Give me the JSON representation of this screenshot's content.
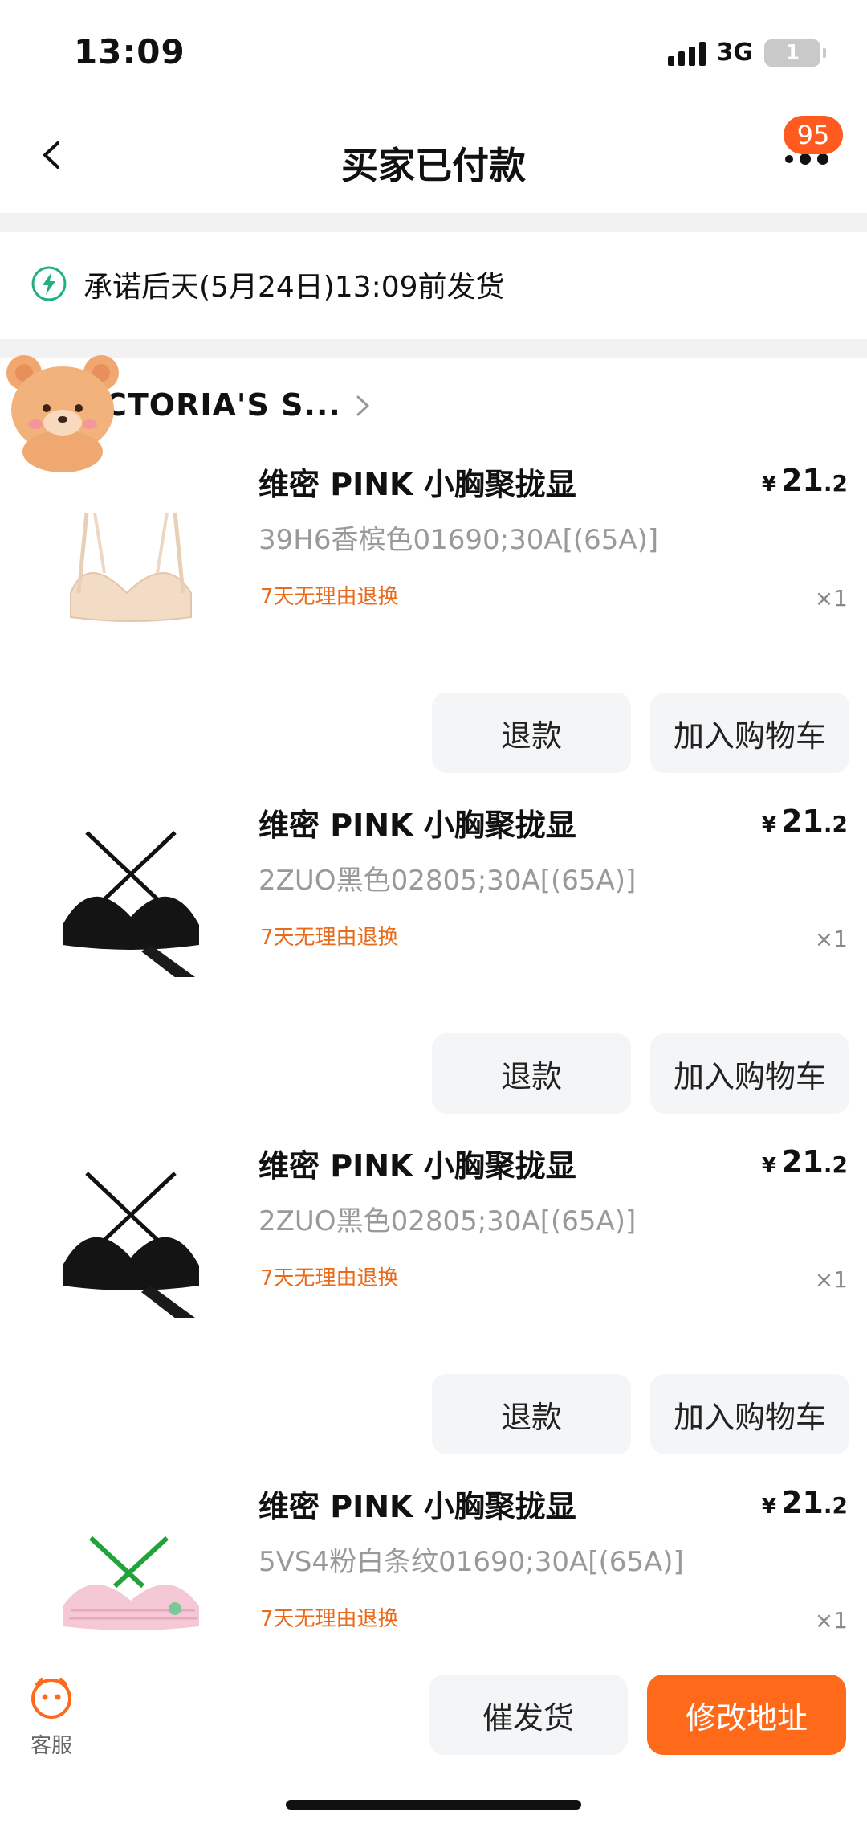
{
  "status_bar": {
    "time": "13:09",
    "network": "3G",
    "battery": "1"
  },
  "nav": {
    "title": "买家已付款",
    "badge_count": "95"
  },
  "promise": {
    "text": "承诺后天(5月24日)13:09前发货"
  },
  "shop": {
    "name": "CTORIA'S S..."
  },
  "products": [
    {
      "title": "维密 PINK 小胸聚拢显",
      "spec": "39H6香槟色01690;30A[(65A)]",
      "tag": "7天无理由退换",
      "price_currency": "¥",
      "price_int": "21",
      "price_dec": ".2",
      "qty": "×1",
      "image": "nude-bra-image",
      "refund_label": "退款",
      "cart_label": "加入购物车"
    },
    {
      "title": "维密 PINK 小胸聚拢显",
      "spec": "2ZUO黑色02805;30A[(65A)]",
      "tag": "7天无理由退换",
      "price_currency": "¥",
      "price_int": "21",
      "price_dec": ".2",
      "qty": "×1",
      "image": "black-bra-image",
      "refund_label": "退款",
      "cart_label": "加入购物车"
    },
    {
      "title": "维密 PINK 小胸聚拢显",
      "spec": "2ZUO黑色02805;30A[(65A)]",
      "tag": "7天无理由退换",
      "price_currency": "¥",
      "price_int": "21",
      "price_dec": ".2",
      "qty": "×1",
      "image": "black-bra-image",
      "refund_label": "退款",
      "cart_label": "加入购物车"
    },
    {
      "title": "维密 PINK 小胸聚拢显",
      "spec": "5VS4粉白条纹01690;30A[(65A)]",
      "tag": "7天无理由退换",
      "price_currency": "¥",
      "price_int": "21",
      "price_dec": ".2",
      "qty": "×1",
      "image": "pink-stripe-bra-image"
    }
  ],
  "bottom": {
    "service_label": "客服",
    "urge_label": "催发货",
    "address_label": "修改地址"
  },
  "colors": {
    "accent": "#ff6a1a",
    "tag": "#e96a1a",
    "promise_icon": "#22b07d"
  }
}
